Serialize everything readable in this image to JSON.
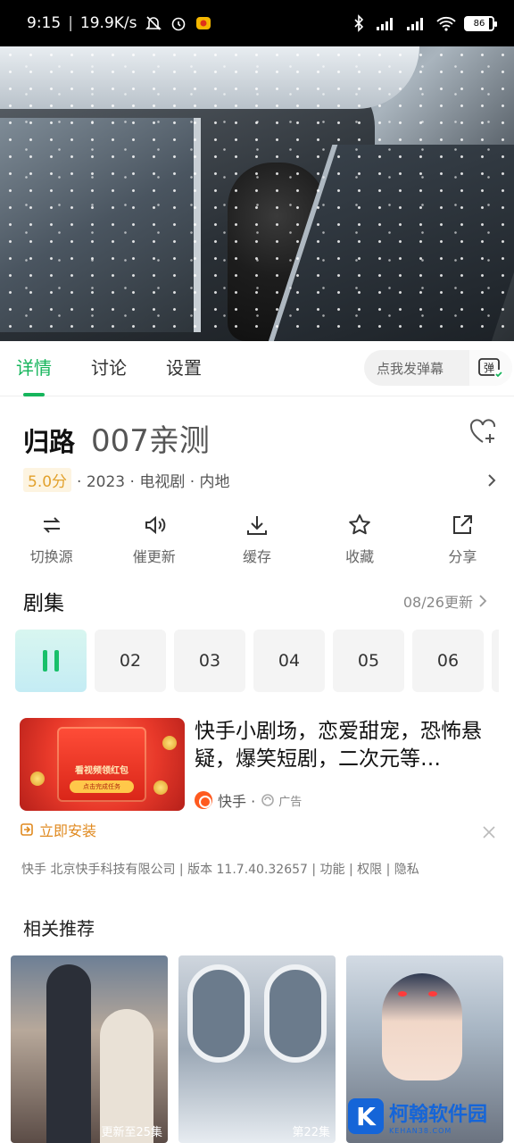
{
  "status_bar": {
    "time": "9:15",
    "net_speed": "19.9K/s",
    "battery": "86"
  },
  "tabs": [
    {
      "label": "详情",
      "active": true
    },
    {
      "label": "讨论",
      "active": false
    },
    {
      "label": "设置",
      "active": false
    }
  ],
  "danmaku": {
    "placeholder": "点我发弹幕",
    "button": "弹"
  },
  "show": {
    "title": "归路",
    "subtitle": "007亲测",
    "score": "5.0分",
    "meta": "· 2023 · 电视剧 · 内地"
  },
  "actions": [
    {
      "label": "切换源",
      "icon": "switch-source-icon"
    },
    {
      "label": "催更新",
      "icon": "speaker-icon"
    },
    {
      "label": "缓存",
      "icon": "download-icon"
    },
    {
      "label": "收藏",
      "icon": "star-icon"
    },
    {
      "label": "分享",
      "icon": "share-icon"
    }
  ],
  "episodes": {
    "title": "剧集",
    "update_text": "08/26更新",
    "items": [
      "02",
      "03",
      "04",
      "05",
      "06"
    ]
  },
  "ad": {
    "image_title": "看视频领红包",
    "image_button": "点击完成任务",
    "text": "快手小剧场，恋爱甜宠，恐怖悬疑，爆笑短剧，二次元等…",
    "source": "快手 ·",
    "tag": "广告",
    "install": "立即安装",
    "legal": "快手 北京快手科技有限公司 | 版本 11.7.40.32657 | 功能 | 权限 | 隐私"
  },
  "related": {
    "title": "相关推荐",
    "items": [
      {
        "badge": "更新至25集"
      },
      {
        "badge": "第22集"
      },
      {
        "badge": ""
      }
    ]
  },
  "watermark": {
    "name": "柯翰软件园",
    "url": "KEHAN38.COM"
  }
}
